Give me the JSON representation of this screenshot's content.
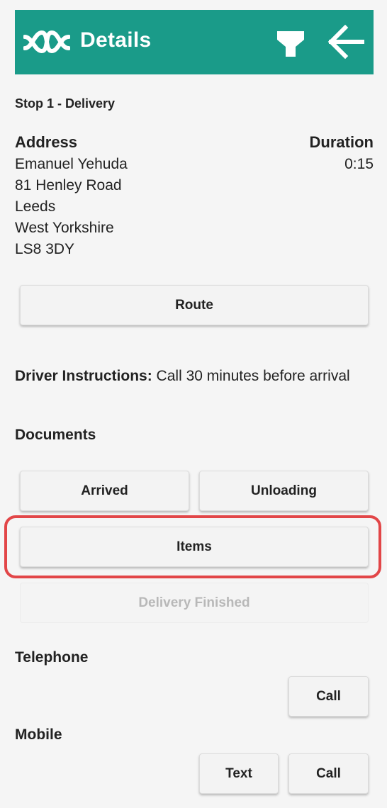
{
  "header": {
    "title": "Details",
    "background": "#1a9b89",
    "logo_icon": "wave-logo-icon",
    "filter_icon": "filter-funnel-icon",
    "back_icon": "arrow-left-icon"
  },
  "stop": {
    "title": "Stop 1 - Delivery"
  },
  "address": {
    "label": "Address",
    "lines": [
      "Emanuel Yehuda",
      "81 Henley Road",
      "Leeds",
      "West Yorkshire",
      "LS8 3DY"
    ]
  },
  "duration": {
    "label": "Duration",
    "value": "0:15"
  },
  "buttons": {
    "route": "Route",
    "arrived": "Arrived",
    "unloading": "Unloading",
    "items": "Items",
    "delivery_finished": "Delivery Finished"
  },
  "instructions": {
    "label": "Driver Instructions:",
    "text": " Call 30 minutes before arrival"
  },
  "documents": {
    "label": "Documents"
  },
  "telephone": {
    "label": "Telephone",
    "call": "Call"
  },
  "mobile": {
    "label": "Mobile",
    "text": "Text",
    "call": "Call"
  },
  "highlight_color": "#e24648"
}
